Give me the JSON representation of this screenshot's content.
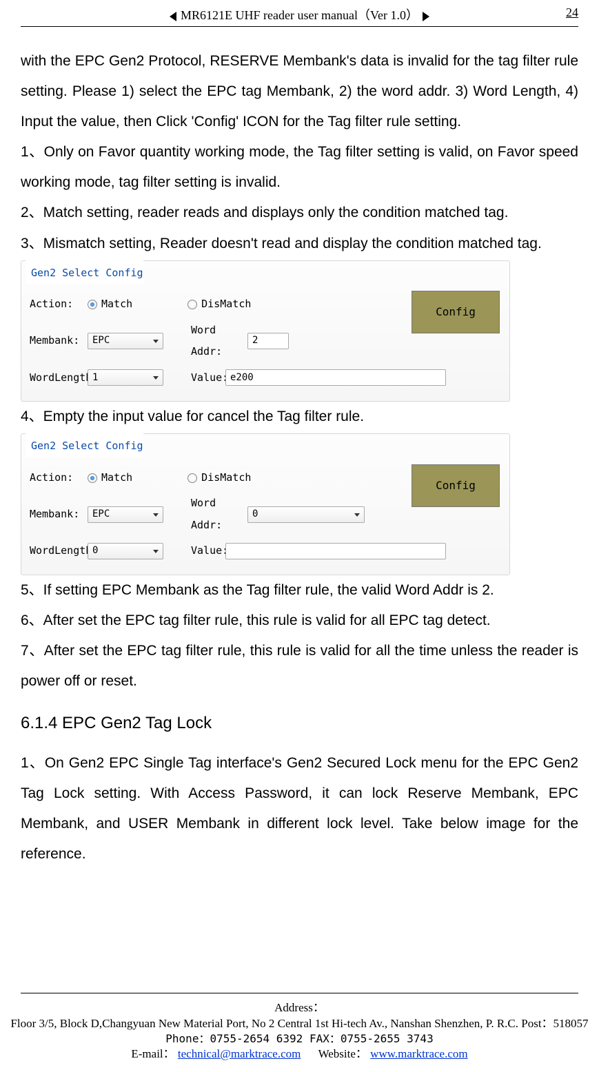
{
  "header": {
    "title": "MR6121E UHF reader user manual（Ver 1.0）",
    "page_number": "24"
  },
  "body": {
    "p0": "with the EPC Gen2 Protocol, RESERVE Membank's data is invalid for the tag filter rule setting. Please 1) select the EPC tag Membank, 2) the word addr. 3) Word Length, 4) Input the value, then Click 'Config' ICON for the Tag filter rule setting.",
    "p1": "1、Only on Favor quantity working mode, the Tag filter setting is valid, on Favor speed working mode, tag filter setting is invalid.",
    "p2": "2、Match setting, reader reads and displays only the condition matched tag.",
    "p3": "3、Mismatch setting, Reader doesn't read and display the condition matched tag.",
    "p4": "4、Empty the input value for cancel the Tag filter rule.",
    "p5": "5、If setting EPC Membank as the Tag filter rule, the valid Word Addr is 2.",
    "p6": "6、After set the EPC tag filter rule, this rule is valid for all EPC tag detect.",
    "p7": "7、After set the EPC tag filter rule, this rule is valid for all the time unless the reader is power off or reset.",
    "h614": "6.1.4 EPC Gen2 Tag Lock",
    "p8": "1、On Gen2 EPC Single Tag interface's Gen2 Secured Lock menu for the EPC Gen2 Tag Lock setting. With Access Password, it can lock Reserve Membank, EPC Membank, and USER Membank in different lock level. Take below image for the reference."
  },
  "fig1": {
    "group_title": "Gen2 Select Config",
    "action_label": "Action:",
    "match_label": "Match",
    "dismatch_label": "DisMatch",
    "membank_label": "Membank:",
    "membank_value": "EPC",
    "wordaddr_label": "Word Addr:",
    "wordaddr_value": "2",
    "wordlength_label": "WordLength:",
    "wordlength_value": "1",
    "value_label": "Value:",
    "value_value": "e200",
    "config_btn": "Config"
  },
  "fig2": {
    "group_title": "Gen2 Select Config",
    "action_label": "Action:",
    "match_label": "Match",
    "dismatch_label": "DisMatch",
    "membank_label": "Membank:",
    "membank_value": "EPC",
    "wordaddr_label": "Word Addr:",
    "wordaddr_value": "0",
    "wordlength_label": "WordLength:",
    "wordlength_value": "0",
    "value_label": "Value:",
    "value_value": "",
    "config_btn": "Config"
  },
  "footer": {
    "addr_label": "Address：",
    "addr_line": "Floor 3/5, Block D,Changyuan New  Material Port, No 2 Central 1st Hi-tech Av., Nanshan Shenzhen, P. R.C.   Post：518057",
    "phone_line": "Phone：0755-2654 6392   FAX：0755-2655 3743",
    "email_label": "E-mail：",
    "email": "technical@marktrace.com",
    "website_label": "Website：",
    "website": "www.marktrace.com"
  }
}
